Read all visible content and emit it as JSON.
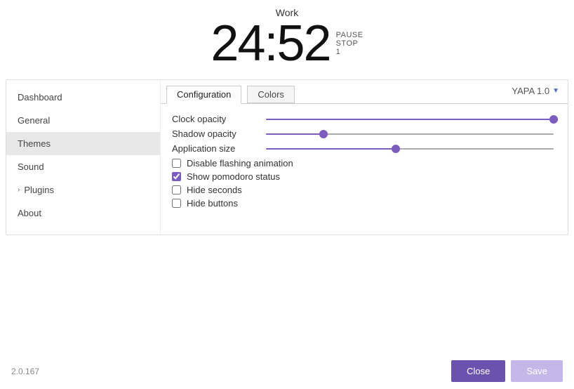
{
  "timer": {
    "label": "Work",
    "time": "24:52",
    "pause_label": "PAUSE",
    "stop_label": "STOP",
    "count": "1"
  },
  "sidebar": {
    "items": [
      {
        "id": "dashboard",
        "label": "Dashboard",
        "active": false,
        "hasChevron": false
      },
      {
        "id": "general",
        "label": "General",
        "active": false,
        "hasChevron": false
      },
      {
        "id": "themes",
        "label": "Themes",
        "active": true,
        "hasChevron": false
      },
      {
        "id": "sound",
        "label": "Sound",
        "active": false,
        "hasChevron": false
      },
      {
        "id": "plugins",
        "label": "Plugins",
        "active": false,
        "hasChevron": true
      },
      {
        "id": "about",
        "label": "About",
        "active": false,
        "hasChevron": false
      }
    ]
  },
  "theme_dropdown": {
    "value": "YAPA 1.0",
    "label": "YAPA 1.0"
  },
  "tabs": {
    "items": [
      {
        "id": "configuration",
        "label": "Configuration",
        "active": true
      },
      {
        "id": "colors",
        "label": "Colors",
        "active": false
      }
    ]
  },
  "sliders": {
    "clock_opacity": {
      "label": "Clock opacity",
      "value": 100,
      "fill_pct": 100
    },
    "shadow_opacity": {
      "label": "Shadow opacity",
      "value": 20,
      "fill_pct": 20
    },
    "application_size": {
      "label": "Application size",
      "value": 45,
      "fill_pct": 45
    }
  },
  "checkboxes": {
    "disable_flashing": {
      "label": "Disable flashing animation",
      "checked": false
    },
    "show_pomodoro": {
      "label": "Show pomodoro status",
      "checked": true
    },
    "hide_seconds": {
      "label": "Hide seconds",
      "checked": false
    },
    "hide_buttons": {
      "label": "Hide buttons",
      "checked": false
    }
  },
  "footer": {
    "version": "2.0.167",
    "close_label": "Close",
    "save_label": "Save"
  }
}
